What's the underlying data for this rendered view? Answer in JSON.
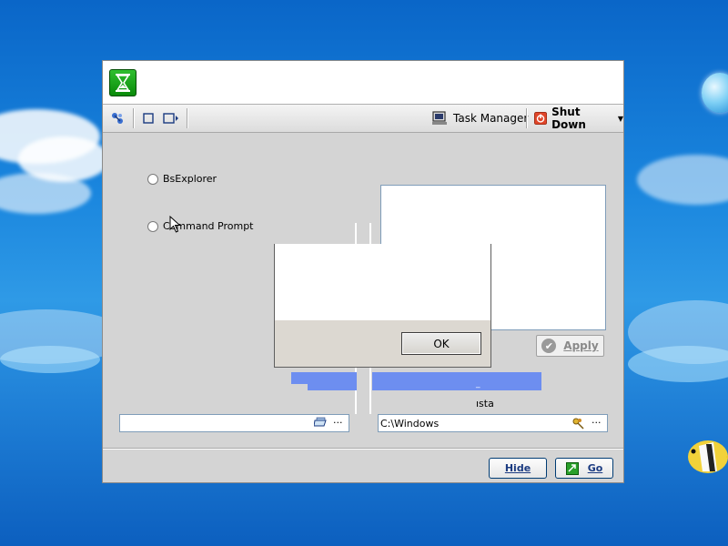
{
  "toolbar": {
    "task_manager_label": "Task Manager",
    "shutdown_label": "Shut Down"
  },
  "options": [
    {
      "label": "BsExplorer"
    },
    {
      "label": "Command Prompt"
    }
  ],
  "apply_label": "Apply",
  "partial_label": "ısta",
  "left_path": {
    "value": ""
  },
  "right_path": {
    "value": "C:\\Windows"
  },
  "browse_label": "···",
  "buttons": {
    "hide": "Hide",
    "go": "Go"
  },
  "dialog": {
    "message": "",
    "ok_label": "OK"
  },
  "colors": {
    "accent_blue": "#6d8ef0",
    "app_icon_green": "#1aa41a",
    "shutdown_red": "#e0462a"
  }
}
